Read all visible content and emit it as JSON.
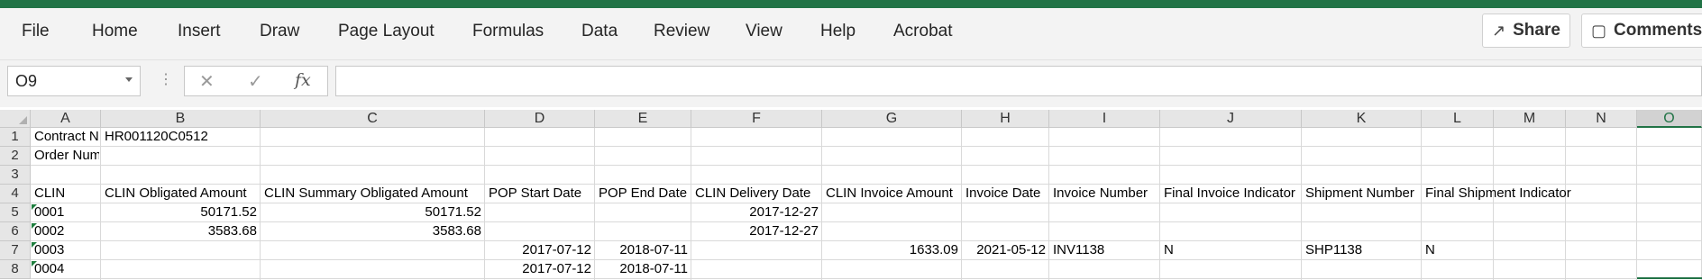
{
  "menu": {
    "items": [
      {
        "key": "file",
        "label": "File"
      },
      {
        "key": "home",
        "label": "Home"
      },
      {
        "key": "insert",
        "label": "Insert"
      },
      {
        "key": "draw",
        "label": "Draw"
      },
      {
        "key": "page_layout",
        "label": "Page Layout"
      },
      {
        "key": "formulas",
        "label": "Formulas"
      },
      {
        "key": "data",
        "label": "Data"
      },
      {
        "key": "review",
        "label": "Review"
      },
      {
        "key": "view",
        "label": "View"
      },
      {
        "key": "help",
        "label": "Help"
      },
      {
        "key": "acrobat",
        "label": "Acrobat"
      }
    ],
    "share_label": "Share",
    "comments_label": "Comments"
  },
  "formula_bar": {
    "name_box": "O9",
    "fx_label": "fx",
    "cancel_icon": "close-icon",
    "enter_icon": "check-icon",
    "formula_value": ""
  },
  "columns": [
    "A",
    "B",
    "C",
    "D",
    "E",
    "F",
    "G",
    "H",
    "I",
    "J",
    "K",
    "L",
    "M",
    "N",
    "O"
  ],
  "selected_column": "O",
  "rows": [
    "1",
    "2",
    "3",
    "4",
    "5",
    "6",
    "7",
    "8"
  ],
  "cells": {
    "A1": "Contract N",
    "B1": "HR001120C0512",
    "A2": "Order Num",
    "A4": "CLIN",
    "B4": "CLIN Obligated Amount",
    "C4": "CLIN Summary Obligated Amount",
    "D4": "POP Start Date",
    "E4": "POP End Date",
    "F4": "CLIN Delivery Date",
    "G4": "CLIN Invoice Amount",
    "H4": "Invoice Date",
    "I4": "Invoice Number",
    "J4": "Final Invoice Indicator",
    "K4": "Shipment Number",
    "L4": "Final Shipment Indicator",
    "A5": "0001",
    "B5": "50171.52",
    "C5": "50171.52",
    "F5": "2017-12-27",
    "A6": "0002",
    "B6": "3583.68",
    "C6": "3583.68",
    "F6": "2017-12-27",
    "A7": "0003",
    "D7": "2017-07-12",
    "E7": "2018-07-11",
    "G7": "1633.09",
    "H7": "2021-05-12",
    "I7": "INV1138",
    "J7": "N",
    "K7": "SHP1138",
    "L7": "N",
    "A8": "0004",
    "D8": "2017-07-12",
    "E8": "2018-07-11"
  },
  "colors": {
    "accent": "#217346",
    "text_marker": "#1e7e3e"
  }
}
